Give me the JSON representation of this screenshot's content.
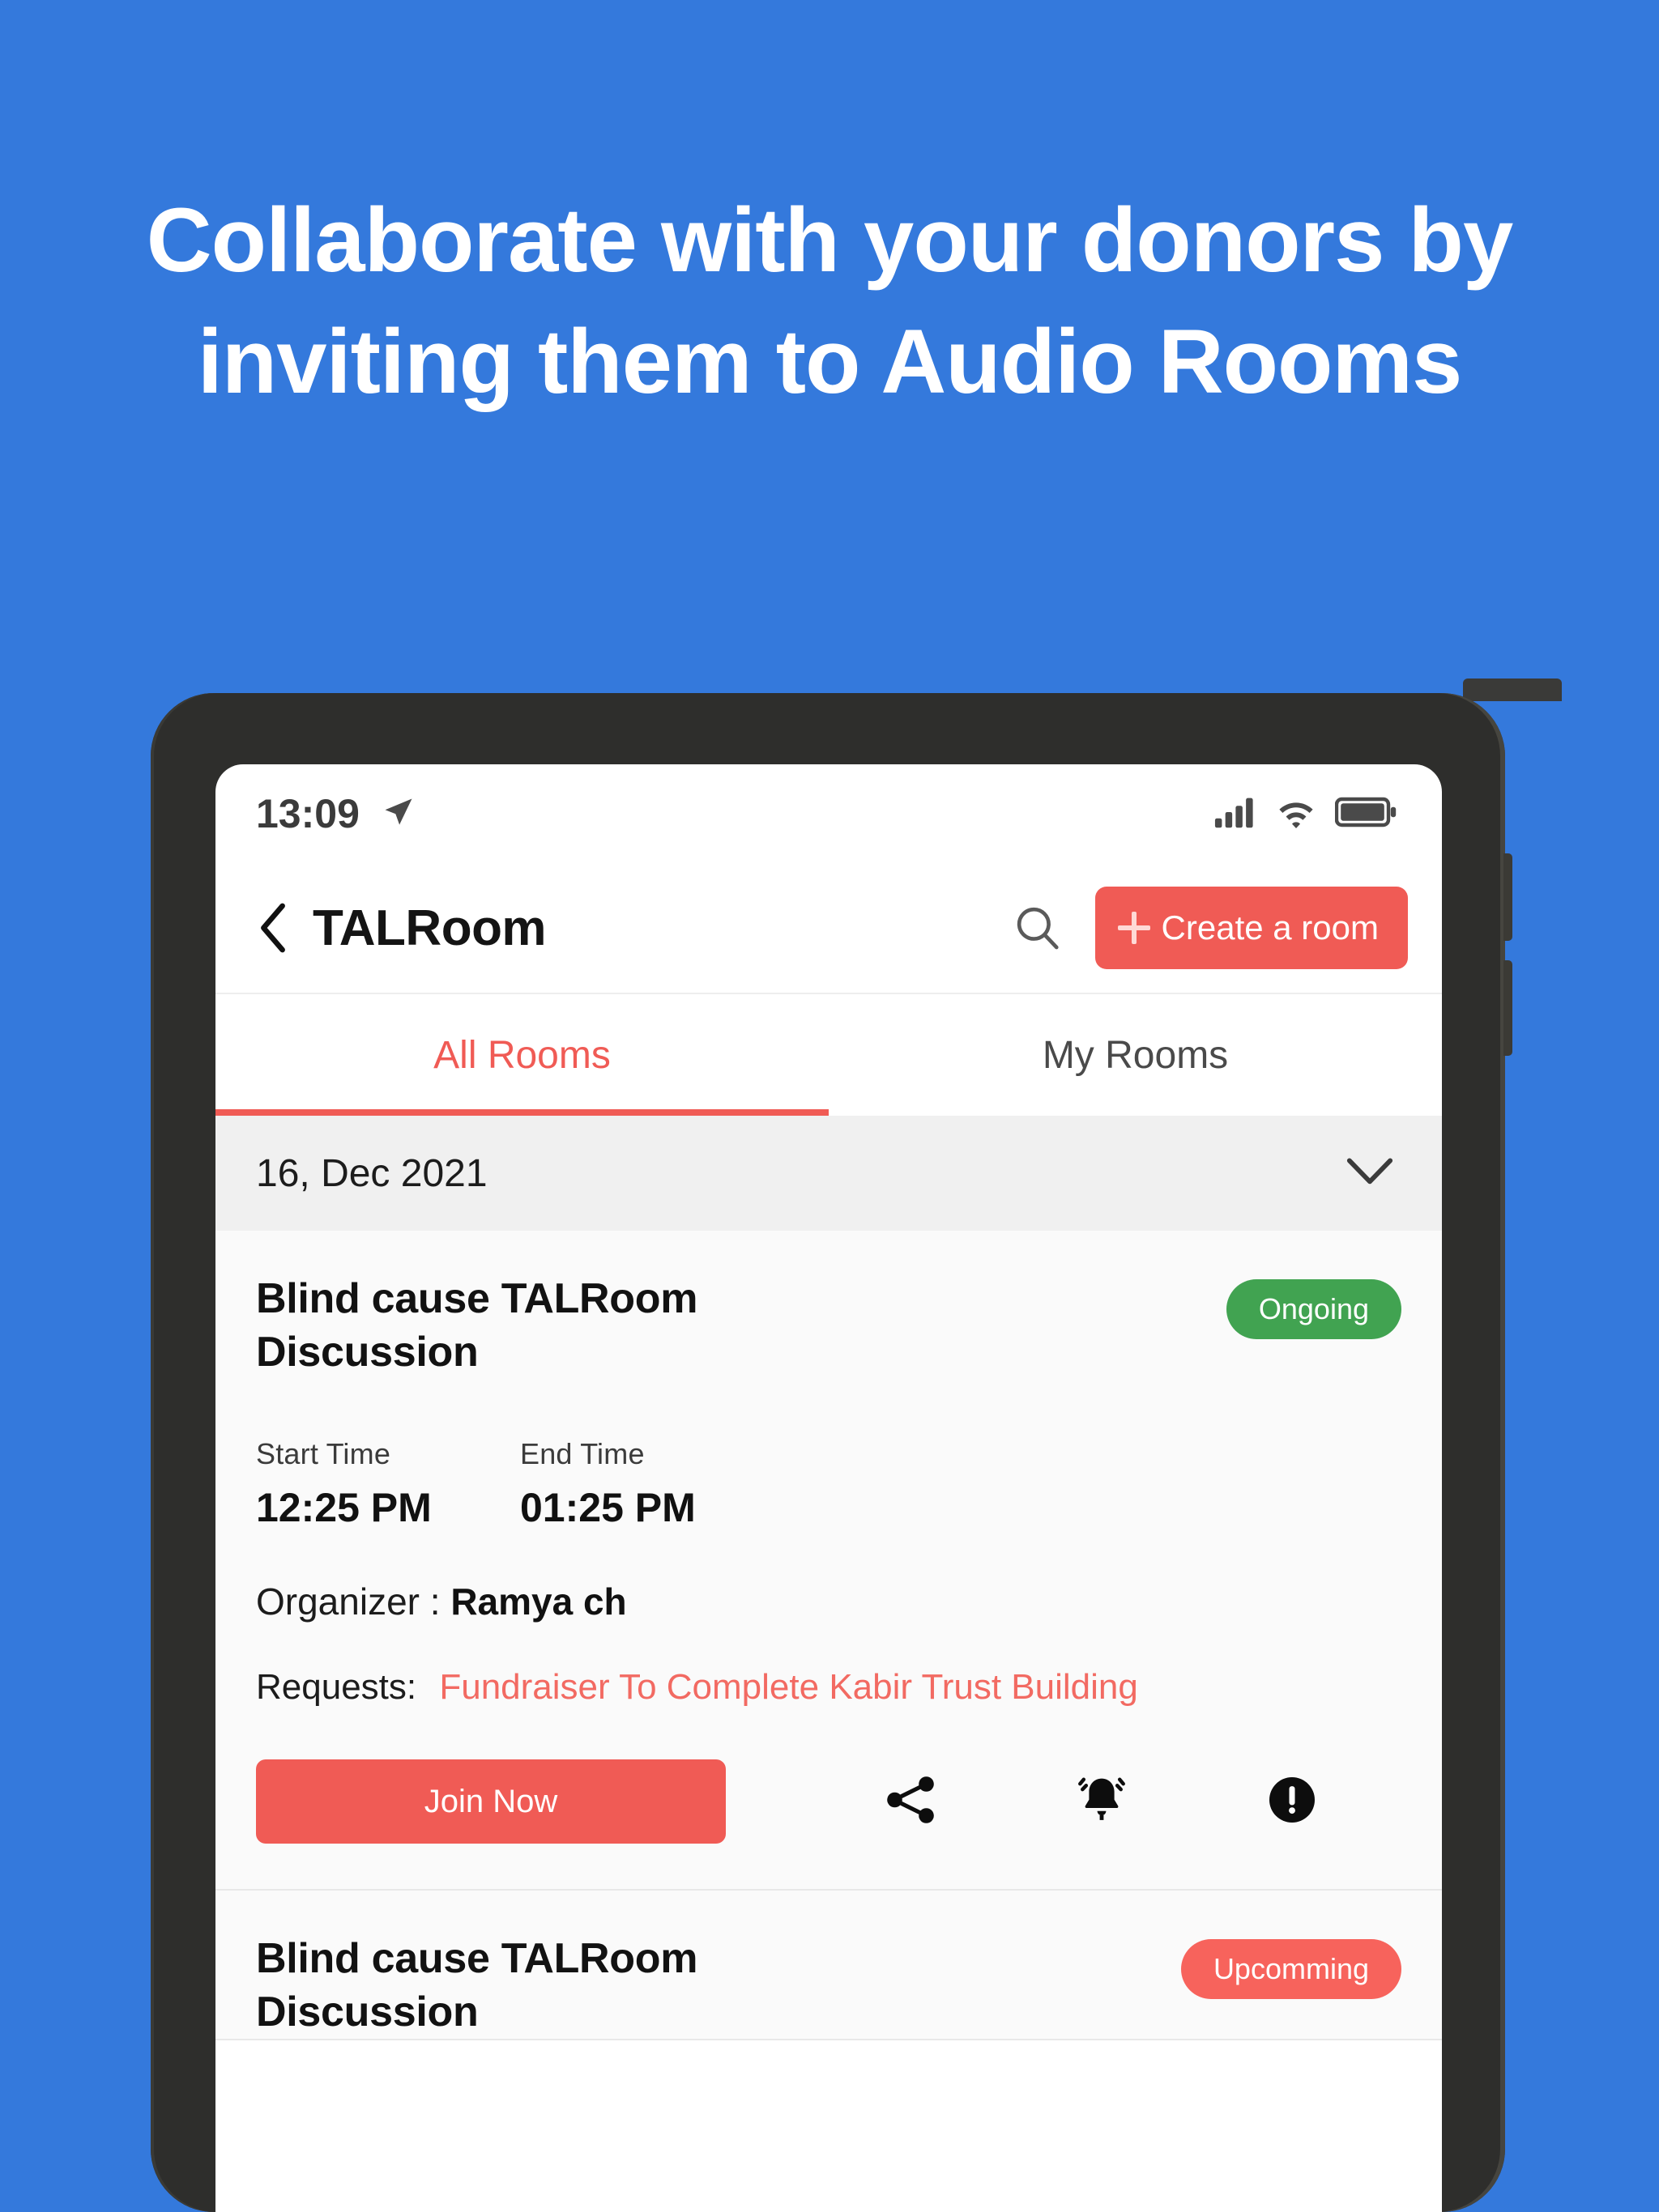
{
  "promo": {
    "headline": "Collaborate with your donors by inviting them to Audio Rooms",
    "background_color": "#3479DC"
  },
  "colors": {
    "accent_red": "#F05B55",
    "status_green": "#41A351",
    "status_upcoming": "#F7635C",
    "blue_background": "#3479DC"
  },
  "status_bar": {
    "time": "13:09",
    "location_icon": "location-arrow-icon",
    "signal_icon": "cellular-signal-icon",
    "wifi_icon": "wifi-icon",
    "battery_icon": "battery-icon"
  },
  "app_bar": {
    "back_icon": "chevron-left-icon",
    "title": "TALRoom",
    "search_icon": "search-icon",
    "create_button": {
      "icon": "plus-icon",
      "label": "Create a room"
    }
  },
  "tabs": [
    {
      "label": "All Rooms",
      "active": true
    },
    {
      "label": "My Rooms",
      "active": false
    }
  ],
  "date_group": {
    "label": "16, Dec 2021",
    "chevron_icon": "chevron-down-icon"
  },
  "rooms": [
    {
      "title": "Blind cause TALRoom Discussion",
      "status": "Ongoing",
      "start_time_label": "Start Time",
      "start_time": "12:25 PM",
      "end_time_label": "End Time",
      "end_time": "01:25 PM",
      "organizer_label": "Organizer :",
      "organizer_name": "Ramya ch",
      "requests_label": "Requests:",
      "requests_value": "Fundraiser To Complete Kabir Trust Building",
      "join_label": "Join Now",
      "actions": [
        "share-icon",
        "bell-ringing-icon",
        "report-alert-icon"
      ]
    },
    {
      "title": "Blind cause TALRoom Discussion",
      "status": "Upcomming"
    }
  ]
}
